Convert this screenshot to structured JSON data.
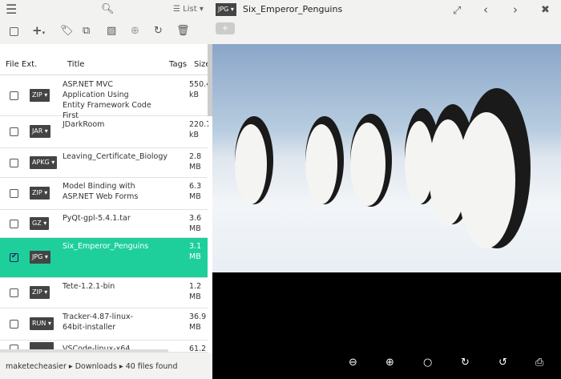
{
  "toolbar": {
    "menu_icon": "hamburger-icon",
    "search_icon": "search-icon",
    "view_label": "List"
  },
  "actions": [
    "checkbox",
    "add-icon",
    "tag-icon",
    "copy-icon",
    "image-icon",
    "zoom-in-icon",
    "refresh-icon",
    "trash-icon"
  ],
  "table": {
    "headers": [
      "File Ext.",
      "Title",
      "Tags",
      "Size"
    ],
    "rows": [
      {
        "ext": "ZIP",
        "title": "ASP.NET MVC Application Using Entity Framework Code First",
        "size": "550.4 kB",
        "selected": false
      },
      {
        "ext": "JAR",
        "title": "JDarkRoom",
        "size": "220.7 kB",
        "selected": false
      },
      {
        "ext": "APKG",
        "title": "Leaving_Certificate_Biology",
        "size": "2.8 MB",
        "selected": false
      },
      {
        "ext": "ZIP",
        "title": "Model Binding with ASP.NET Web Forms",
        "size": "6.3 MB",
        "selected": false
      },
      {
        "ext": "GZ",
        "title": "PyQt-gpl-5.4.1.tar",
        "size": "3.6 MB",
        "selected": false
      },
      {
        "ext": "JPG",
        "title": "Six_Emperor_Penguins",
        "size": "3.1 MB",
        "selected": true
      },
      {
        "ext": "ZIP",
        "title": "Tete-1.2.1-bin",
        "size": "1.2 MB",
        "selected": false
      },
      {
        "ext": "RUN",
        "title": "Tracker-4.87-linux-64bit-installer",
        "size": "36.9 MB",
        "selected": false
      },
      {
        "ext": "",
        "title": "VSCode-linux-x64",
        "size": "61.2",
        "selected": false
      }
    ]
  },
  "footer": {
    "path": [
      "maketecheasier",
      "Downloads"
    ],
    "count": "40 files found"
  },
  "preview": {
    "ext": "JPG",
    "title": "Six_Emperor_Penguins",
    "accent": "#1ecf9c"
  }
}
